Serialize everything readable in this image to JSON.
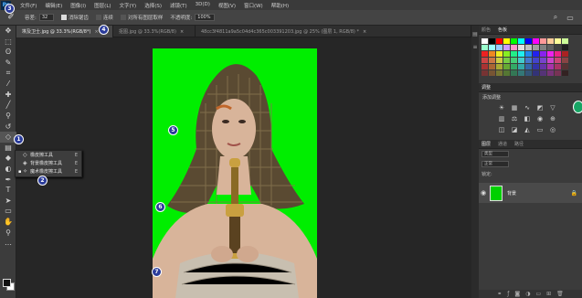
{
  "app": {
    "logo": "Ps"
  },
  "menu": [
    "文件(F)",
    "编辑(E)",
    "图像(I)",
    "图层(L)",
    "文字(Y)",
    "选择(S)",
    "滤镜(T)",
    "3D(D)",
    "视图(V)",
    "窗口(W)",
    "帮助(H)"
  ],
  "options": {
    "tolerance_label": "容差:",
    "tolerance_value": "32",
    "antialias_label": "消除锯齿",
    "contiguous_label": "连续",
    "sample_all_label": "对所有图层取样",
    "opacity_label": "不透明度:",
    "opacity_value": "100%"
  },
  "tabs": [
    {
      "label": "埃及卫士.jpg @ 33.3%(RGB/8*)",
      "close": "×"
    },
    {
      "label": "抠图.jpg @ 33.3%(RGB/8)",
      "close": "×"
    },
    {
      "label": "48cc3f4811a9a5c04d4c365c003391203.jpg @ 25% (图层 1, RGB/8) *",
      "close": "×"
    }
  ],
  "flyout": {
    "items": [
      {
        "label": "橡皮擦工具",
        "key": "E",
        "icon": "eraser-icon",
        "selected": false
      },
      {
        "label": "背景橡皮擦工具",
        "key": "E",
        "icon": "background-eraser-icon",
        "selected": false
      },
      {
        "label": "魔术橡皮擦工具",
        "key": "E",
        "icon": "magic-eraser-icon",
        "selected": true
      }
    ]
  },
  "badges": [
    "1",
    "2",
    "3",
    "4",
    "5",
    "6",
    "7"
  ],
  "panels": {
    "swatch_tabs": [
      "颜色",
      "色板"
    ],
    "adjust_tabs": [
      "调整"
    ],
    "adjust_title": "添加调整",
    "layers_tabs": [
      "图层",
      "通道",
      "路径"
    ],
    "kind_label": "类型",
    "blend_label": "正常",
    "lock_label": "锁定:",
    "layer": {
      "name": "背景",
      "lock": "🔒"
    }
  },
  "colors": {
    "canvas_green": "#00ee00",
    "badge_blue": "#2a3b9a",
    "swatches": [
      "#ffffff",
      "#000000",
      "#ff0000",
      "#ffff00",
      "#00ff00",
      "#00ffff",
      "#0000ff",
      "#ff00ff",
      "#ff9999",
      "#ffcc99",
      "#ffff99",
      "#ccff99",
      "#99ffcc",
      "#99ffff",
      "#99ccff",
      "#cc99ff",
      "#ff99cc",
      "#e0e0e0",
      "#c0c0c0",
      "#a0a0a0",
      "#808080",
      "#606060",
      "#404040",
      "#202020",
      "#ee2222",
      "#ee8822",
      "#eeee22",
      "#88ee22",
      "#22ee88",
      "#22eeee",
      "#2288ee",
      "#2222ee",
      "#8822ee",
      "#ee22ee",
      "#ee2288",
      "#aa2222",
      "#cc4444",
      "#cc7744",
      "#cccc44",
      "#77cc44",
      "#44cc77",
      "#44cccc",
      "#4477cc",
      "#4444cc",
      "#7744cc",
      "#cc44cc",
      "#cc4477",
      "#884444",
      "#aa3333",
      "#aa6633",
      "#aaaa33",
      "#66aa33",
      "#33aa66",
      "#33aaaa",
      "#3366aa",
      "#3333aa",
      "#6633aa",
      "#aa33aa",
      "#aa3366",
      "#553333",
      "#773333",
      "#775533",
      "#777733",
      "#557733",
      "#337755",
      "#337777",
      "#335577",
      "#333377",
      "#553377",
      "#773377",
      "#773355",
      "#332222"
    ]
  }
}
